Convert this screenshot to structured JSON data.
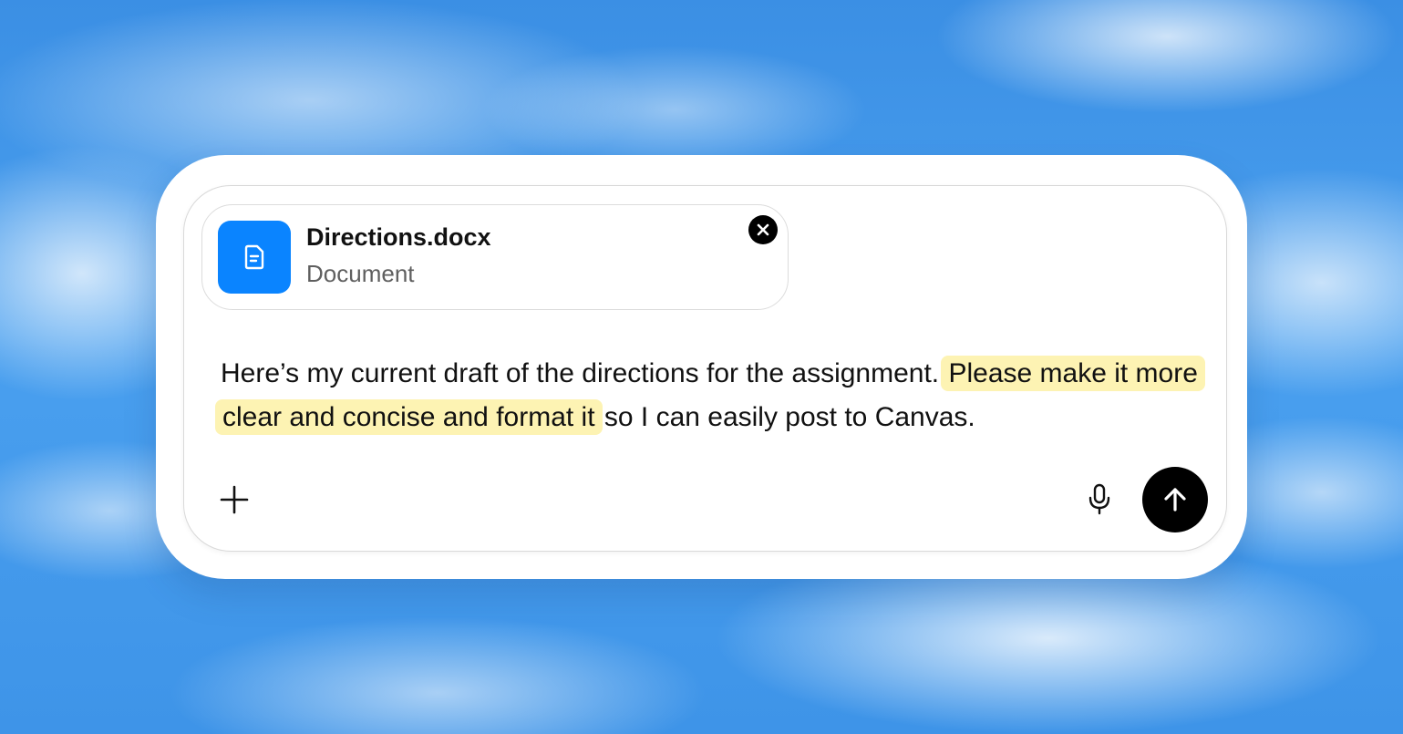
{
  "attachment": {
    "file_name": "Directions.docx",
    "file_type": "Document",
    "icon": "document-icon",
    "icon_color": "#0a84ff",
    "remove_icon": "close-icon"
  },
  "message": {
    "segments": [
      {
        "text": "Here’s my current draft of the directions for the assignment. ",
        "highlight": false
      },
      {
        "text": "Please make it more clear and concise and format it",
        "highlight": true
      },
      {
        "text": " so I can easily post to Canvas.",
        "highlight": false
      }
    ],
    "highlight_color": "#fdf3b3"
  },
  "toolbar": {
    "add_icon": "plus-icon",
    "mic_icon": "microphone-icon",
    "send_icon": "arrow-up-icon"
  }
}
